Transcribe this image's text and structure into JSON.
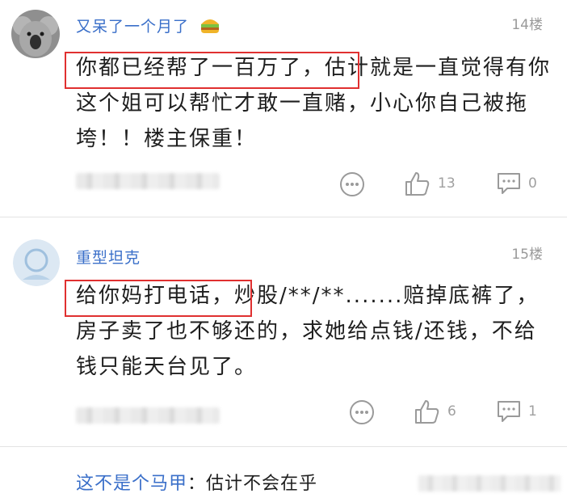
{
  "posts": [
    {
      "username": "又呆了一个月了",
      "badge_icon": "burger-badge-icon",
      "floor": "14楼",
      "highlight": "你都已经帮了一百万了，",
      "text_rest": "估计就是一直觉得有你这个姐可以帮忙才敢一直赌，小心你自己被拖垮！！楼主保重！",
      "likes": "13",
      "comments": "0"
    },
    {
      "username": "重型坦克",
      "floor": "15楼",
      "highlight": "给你妈打电话，",
      "text_rest": "炒股/**/**.......赔掉底裤了，房子卖了也不够还的，求她给点钱/还钱，不给钱只能天台见了。",
      "likes": "6",
      "comments": "1"
    }
  ],
  "sub_reply": {
    "user": "这不是个马甲",
    "separator": "：",
    "text": "估计不会在乎"
  },
  "colors": {
    "username": "#3a6fc9",
    "highlight_border": "#e03030",
    "meta": "#9a9a9a"
  }
}
